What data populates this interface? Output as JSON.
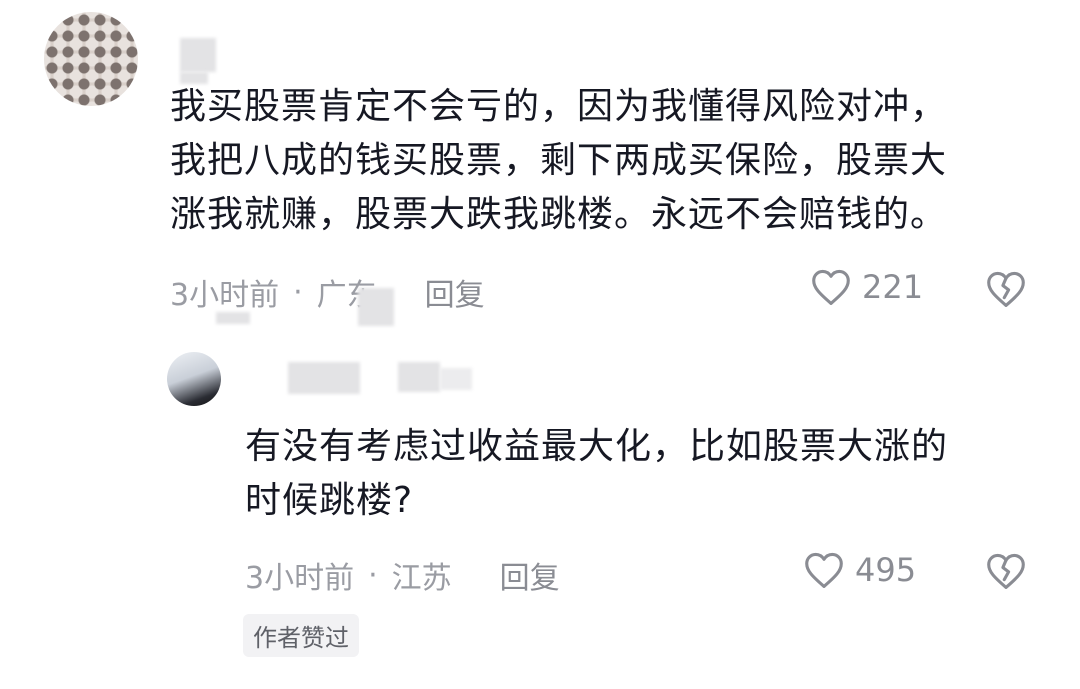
{
  "comment": {
    "text": "我买股票肯定不会亏的，因为我懂得风险对冲，\n我把八成的钱买股票，剩下两成买保险，股票大\n涨我就赚，股票大跌我跳楼。永远不会赔钱的。",
    "time": "3小时前",
    "separator": "·",
    "location": "广东",
    "reply_label": "回复",
    "like_count": "221",
    "icons": {
      "like": "heart-outline-icon",
      "dislike": "broken-heart-icon"
    }
  },
  "reply": {
    "text": "有没有考虑过收益最大化，比如股票大涨的\n时候跳楼?",
    "time": "3小时前",
    "separator": "·",
    "location": "江苏",
    "reply_label": "回复",
    "like_count": "495",
    "author_badge": "作者赞过",
    "icons": {
      "like": "heart-outline-icon",
      "dislike": "broken-heart-icon"
    }
  },
  "colors": {
    "text": "#161823",
    "meta": "#9a9ca3",
    "icon": "#8a8c93",
    "badge_bg": "#f2f2f4"
  }
}
